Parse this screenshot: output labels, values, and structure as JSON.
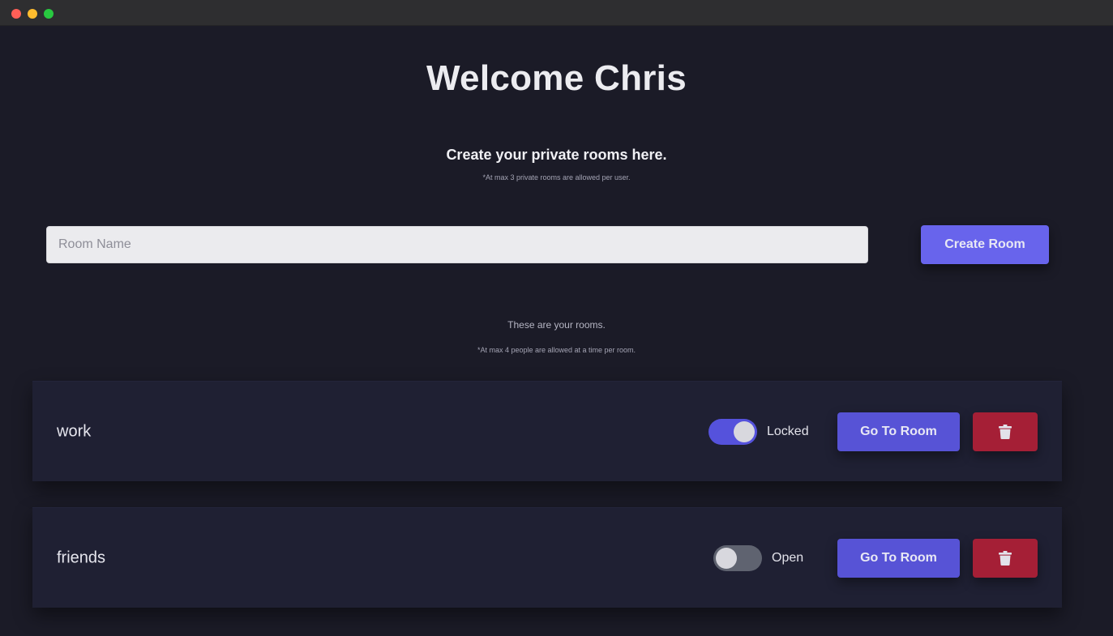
{
  "window": {
    "traffic_lights": [
      "close",
      "minimize",
      "maximize"
    ]
  },
  "header": {
    "title": "Welcome Chris"
  },
  "create_section": {
    "heading": "Create your private rooms here.",
    "note": "*At max 3 private rooms are allowed per user.",
    "input_placeholder": "Room Name",
    "input_value": "",
    "button_label": "Create Room"
  },
  "rooms_section": {
    "heading": "These are your rooms.",
    "note": "*At max 4 people are allowed at a time per room."
  },
  "rooms": [
    {
      "name": "work",
      "locked": true,
      "status_label": "Locked",
      "goto_label": "Go To Room",
      "delete_icon": "trash-icon"
    },
    {
      "name": "friends",
      "locked": false,
      "status_label": "Open",
      "goto_label": "Go To Room",
      "delete_icon": "trash-icon"
    }
  ],
  "colors": {
    "background": "#1b1b27",
    "card": "#1f2033",
    "accent": "#6864ec",
    "goto": "#5753d6",
    "danger": "#a51f36",
    "toggle_off": "#5f6370"
  }
}
